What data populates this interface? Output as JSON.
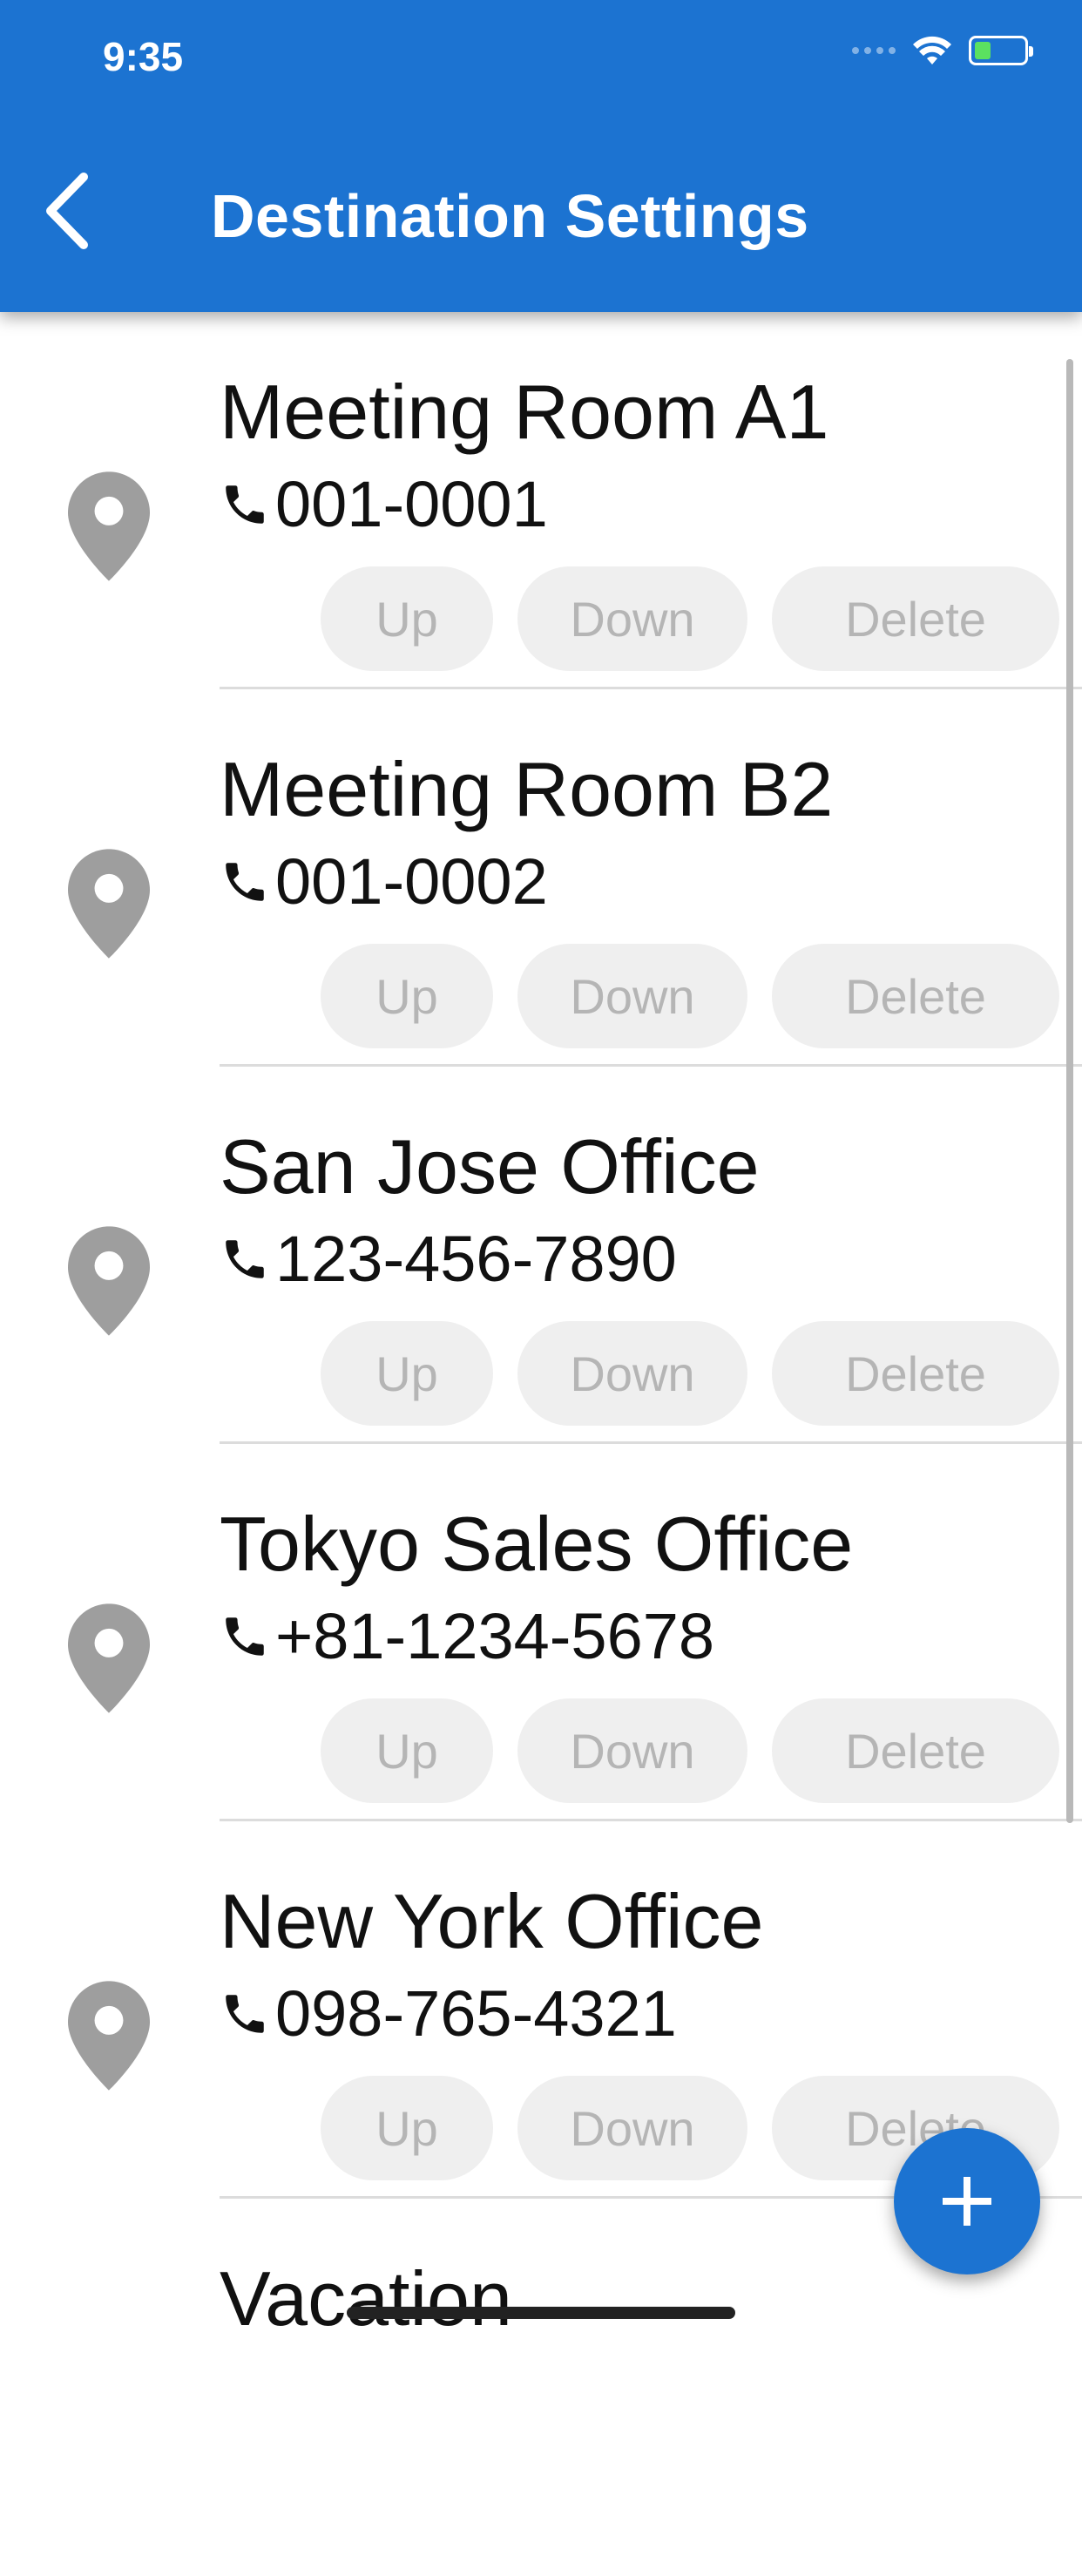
{
  "status_bar": {
    "time": "9:35"
  },
  "header": {
    "title": "Destination Settings"
  },
  "destinations": [
    {
      "name": "Meeting Room A1",
      "phone": "001-0001"
    },
    {
      "name": "Meeting Room B2",
      "phone": "001-0002"
    },
    {
      "name": "San Jose Office",
      "phone": "123-456-7890"
    },
    {
      "name": "Tokyo Sales Office",
      "phone": "+81-1234-5678"
    },
    {
      "name": "New York Office",
      "phone": "098-765-4321"
    },
    {
      "name": "Vacation",
      "phone": ""
    }
  ],
  "buttons": {
    "up": "Up",
    "down": "Down",
    "delete": "Delete"
  },
  "colors": {
    "primary": "#1C73D1",
    "button_bg": "#EFEFEF",
    "button_text": "#B5B5B5",
    "pin": "#9E9E9E"
  },
  "icons": {
    "back": "chevron-left-icon",
    "pin": "location-pin-icon",
    "phone": "phone-icon",
    "add": "plus-icon"
  }
}
